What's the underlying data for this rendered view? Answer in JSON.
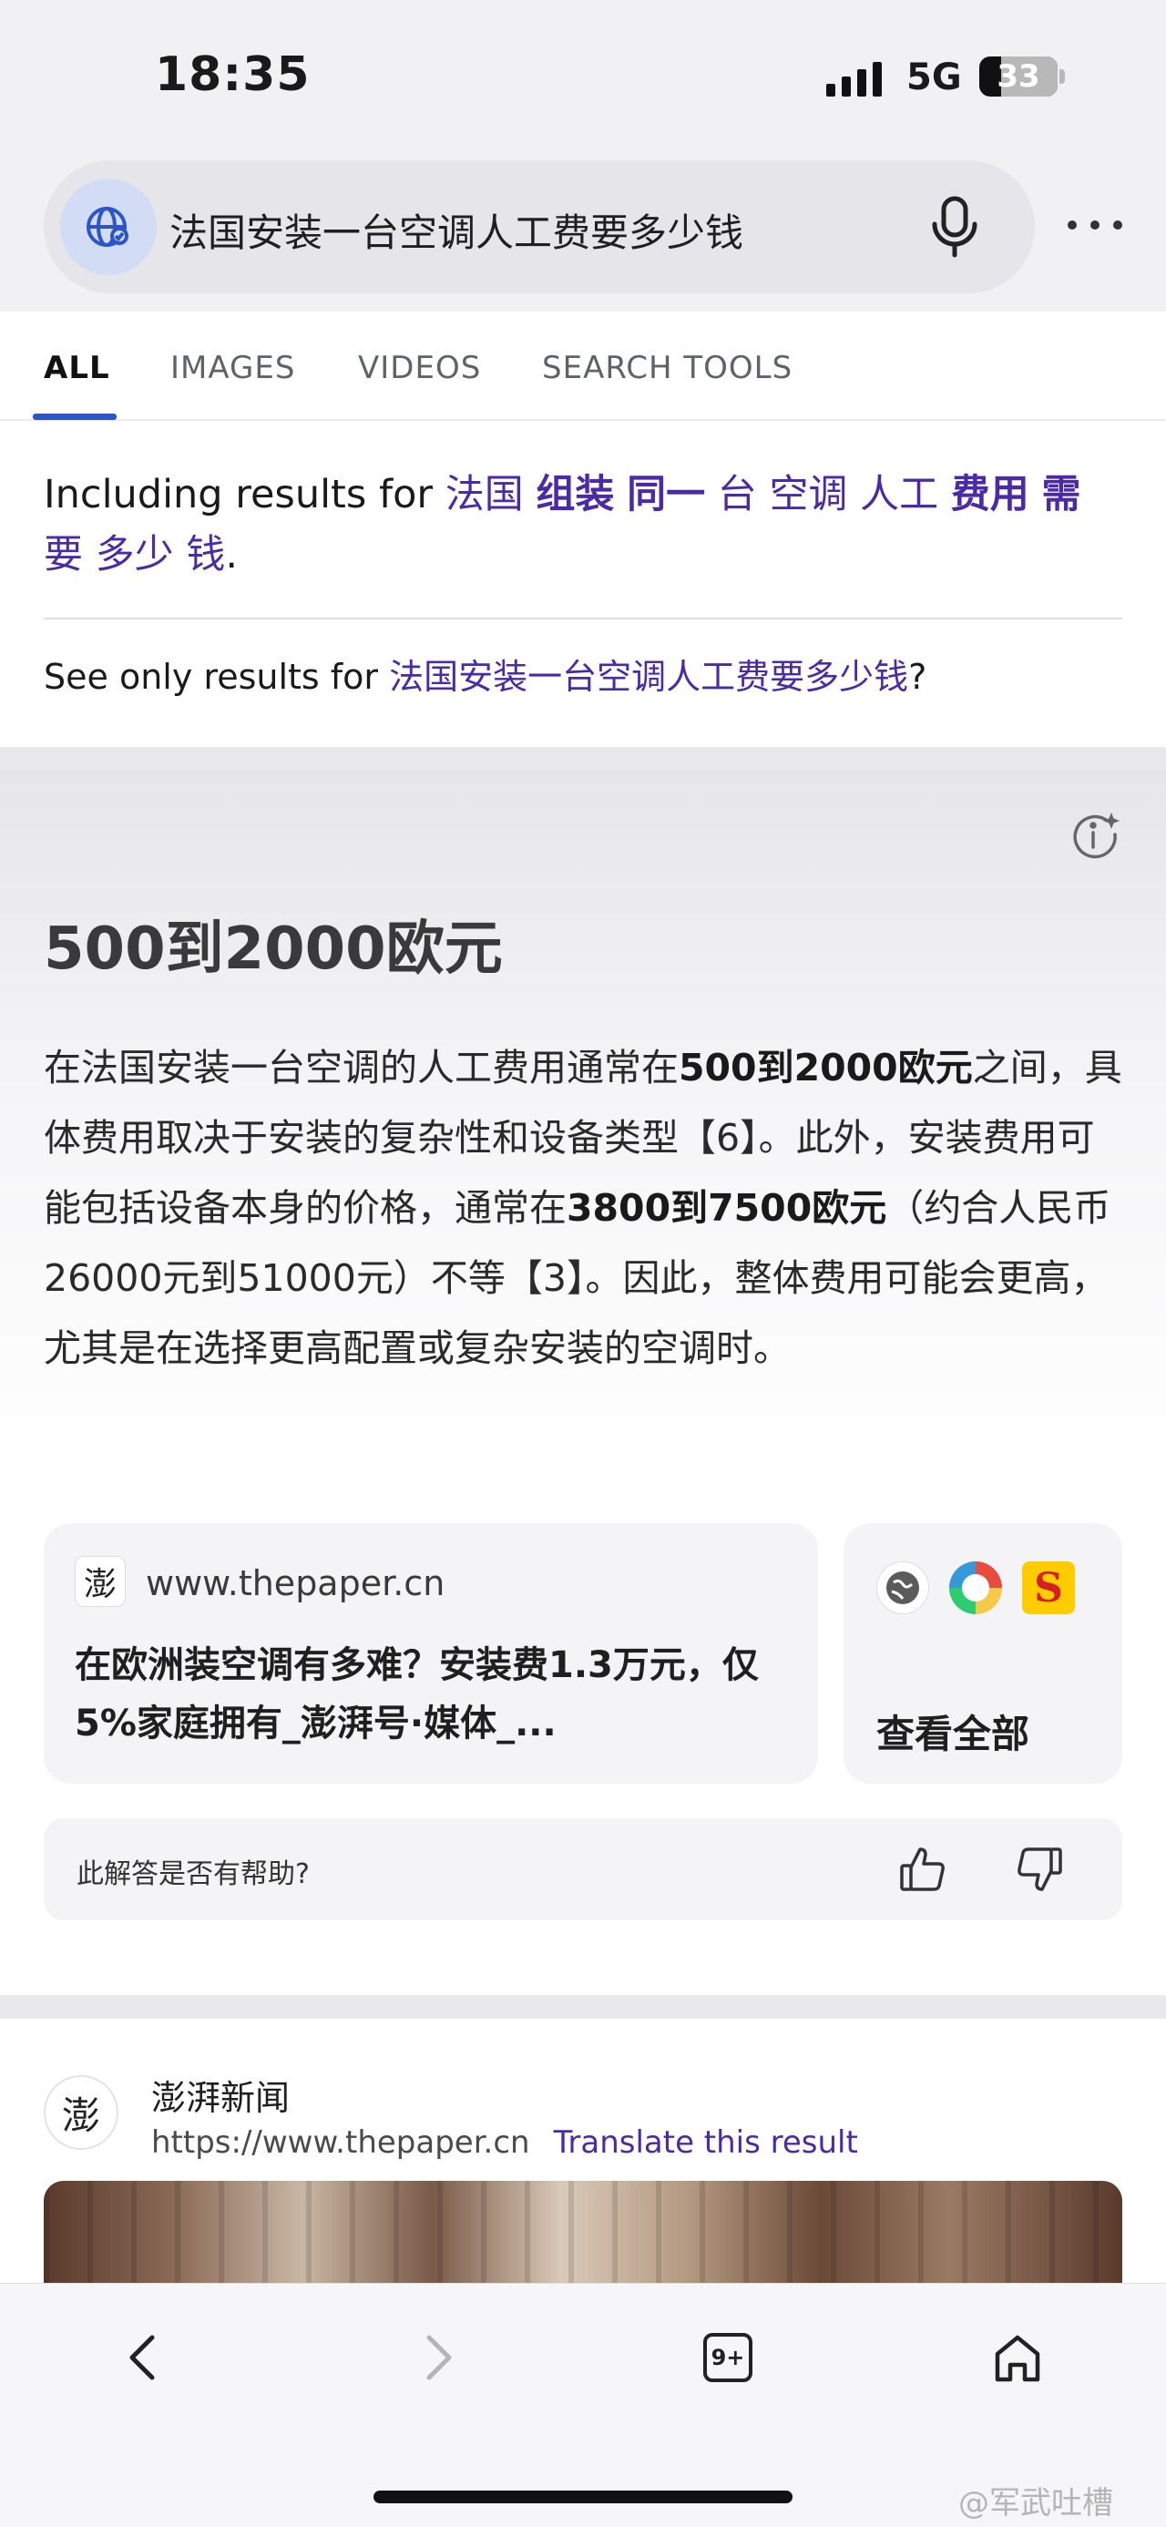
{
  "status_bar": {
    "time": "18:35",
    "network": "5G",
    "battery": "33"
  },
  "search": {
    "query": "法国安装一台空调人工费要多少钱"
  },
  "tabs": [
    {
      "label": "ALL",
      "active": true
    },
    {
      "label": "IMAGES",
      "active": false
    },
    {
      "label": "VIDEOS",
      "active": false
    },
    {
      "label": "SEARCH TOOLS",
      "active": false
    }
  ],
  "including": {
    "prefix": "Including results for ",
    "terms": [
      "法国",
      "组装",
      "同一",
      "台",
      "空调",
      "人工",
      "费用",
      "需",
      "要",
      "多少",
      "钱"
    ],
    "suffix": "."
  },
  "see_only": {
    "prefix": "See only results for ",
    "query": "法国安装一台空调人工费要多少钱",
    "suffix": "?"
  },
  "ai_answer": {
    "headline": "500到2000欧元",
    "body": {
      "p1": "在法国安装一台空调的人工费用通常在",
      "b1": "500到2000欧元",
      "p2": "之间，具体费用取决于安装的复杂性和设备类型【6】。此外，安装费用可能包括设备本身的价格，通常在",
      "b2": "3800到7500欧元",
      "p3": "（约合人民币26000元到51000元）不等【3】。因此，整体费用可能会更高，尤其是在选择更高配置或复杂安装的空调时。"
    }
  },
  "source_card": {
    "logo_char": "澎",
    "domain": "www.thepaper.cn",
    "title": "在欧洲装空调有多难？安装费1.3万元，仅5%家庭拥有_澎湃号·媒体_..."
  },
  "see_all": {
    "label": "查看全部",
    "icon3_char": "S"
  },
  "feedback": {
    "question": "此解答是否有帮助?"
  },
  "result": {
    "logo_char": "澎",
    "source": "澎湃新闻",
    "url": "https://www.thepaper.cn",
    "translate": "Translate this result"
  },
  "toolbar": {
    "tab_count": "9+"
  },
  "watermark": "@军武吐槽",
  "colors": {
    "link": "#4b2aa8",
    "accent": "#2b55c9",
    "background": "#ffffff"
  }
}
